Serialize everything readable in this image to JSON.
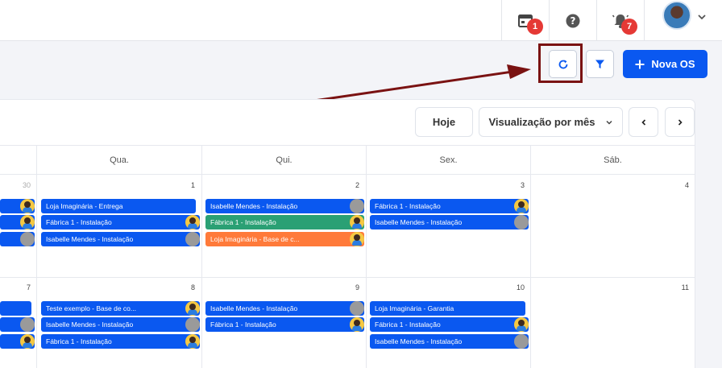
{
  "topbar": {
    "calendar_badge": "1",
    "notifications_badge": "7"
  },
  "actions": {
    "new_os_label": "Nova OS",
    "new_os_icon": "plus-icon"
  },
  "calendar": {
    "today_label": "Hoje",
    "view_label": "Visualização por mês",
    "day_names": [
      "Qua.",
      "Qui.",
      "Sex.",
      "Sáb."
    ],
    "week1": {
      "d_prev": "30",
      "d_wed": "1",
      "d_thu": "2",
      "d_fri": "3",
      "d_sat": "4",
      "wed": [
        "Loja Imaginária - Entrega",
        "Fábrica 1 - Instalação",
        "Isabelle Mendes - Instalação"
      ],
      "thu": [
        "Isabelle Mendes - Instalação",
        "Fábrica 1 - Instalação",
        "Loja Imaginária - Base de c..."
      ],
      "fri": [
        "Fábrica 1 - Instalação",
        "Isabelle Mendes - Instalação"
      ]
    },
    "week2": {
      "d_prev": "7",
      "d_wed": "8",
      "d_thu": "9",
      "d_fri": "10",
      "d_sat": "11",
      "wed": [
        "Teste exemplo - Base de co...",
        "Isabelle Mendes - Instalação",
        "Fábrica 1 - Instalação"
      ],
      "thu": [
        "Isabelle Mendes - Instalação",
        "Fábrica 1 - Instalação"
      ],
      "fri": [
        "Loja Imaginária - Garantia",
        "Fábrica 1 - Instalação",
        "Isabelle Mendes - Instalação"
      ]
    }
  },
  "colors": {
    "primary": "#0a58f0",
    "green_event": "#2aa074",
    "orange_event": "#ff7a3a",
    "badge": "#e53935",
    "annotation": "#7a1212"
  }
}
